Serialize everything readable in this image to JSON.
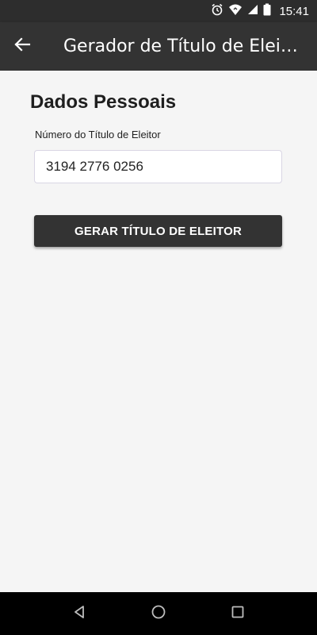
{
  "status_bar": {
    "time": "15:41",
    "icons": [
      "alarm-icon",
      "wifi-icon",
      "signal-icon",
      "battery-icon"
    ]
  },
  "app_bar": {
    "back_icon": "arrow-left-icon",
    "title": "Gerador de Título de Eleitor"
  },
  "form": {
    "section_title": "Dados Pessoais",
    "field_label": "Número do Título de Eleitor",
    "field_value": "3194 2776 0256",
    "button_label": "GERAR TÍTULO DE ELEITOR"
  },
  "nav_bar": {
    "icons": [
      "back-triangle-icon",
      "home-circle-icon",
      "recents-square-icon"
    ]
  },
  "colors": {
    "app_bar": "#333333",
    "status_bar": "#2d2d2d",
    "background": "#f5f5f5",
    "button": "#333333"
  }
}
